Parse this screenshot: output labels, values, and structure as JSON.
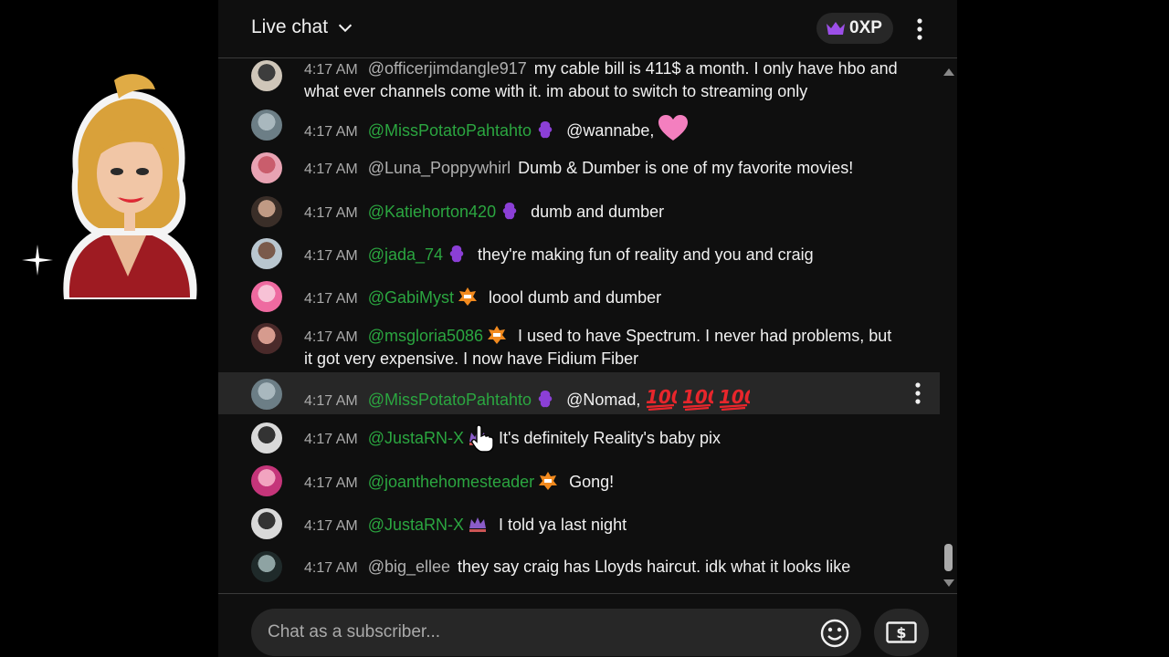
{
  "header": {
    "title": "Live chat",
    "xp_label": "0XP"
  },
  "messages": [
    {
      "time": "4:17 AM",
      "author": "@officerjimdangle917",
      "badge": null,
      "text": "my cable bill is 411$ a month. I only have hbo and what ever channels come with it. im about to switch to streaming only"
    },
    {
      "time": "4:17 AM",
      "author": "@MissPotatoPahtahto",
      "badge": "member-badge-purple",
      "text": "@wannabe,",
      "emoji": [
        "pink-heart"
      ]
    },
    {
      "time": "4:17 AM",
      "author": "@Luna_Poppywhirl",
      "badge": null,
      "text": "Dumb & Dumber is one of my favorite movies!"
    },
    {
      "time": "4:17 AM",
      "author": "@Katiehorton420",
      "badge": "member-badge-purple",
      "text": "dumb and dumber"
    },
    {
      "time": "4:17 AM",
      "author": "@jada_74",
      "badge": "member-badge-purple",
      "text": "they're making fun of reality and you and craig"
    },
    {
      "time": "4:17 AM",
      "author": "@GabiMyst",
      "badge": "member-badge-wtf",
      "text": "loool dumb and dumber"
    },
    {
      "time": "4:17 AM",
      "author": "@msgloria5086",
      "badge": "member-badge-wtf",
      "text": "I used to have Spectrum. I never had problems, but it got very expensive. I now have Fidium Fiber"
    },
    {
      "time": "4:17 AM",
      "author": "@MissPotatoPahtahto",
      "badge": "member-badge-purple",
      "text": "@Nomad,",
      "emoji": [
        "hundred",
        "hundred",
        "hundred"
      ],
      "highlighted": true
    },
    {
      "time": "4:17 AM",
      "author": "@JustaRN-X",
      "badge": "member-badge-crown",
      "text": "It's definitely Reality's baby pix"
    },
    {
      "time": "4:17 AM",
      "author": "@joanthehomesteader",
      "badge": "member-badge-wtf",
      "text": "Gong!"
    },
    {
      "time": "4:17 AM",
      "author": "@JustaRN-X",
      "badge": "member-badge-crown",
      "text": "I told ya last night"
    },
    {
      "time": "4:17 AM",
      "author": "@big_ellee",
      "badge": null,
      "text": "they say craig has Lloyds haircut. idk what it looks like"
    }
  ],
  "input": {
    "placeholder": "Chat as a subscriber..."
  },
  "colors": {
    "panel_bg": "#0f0f0f",
    "member_name": "#2ba640",
    "timestamp": "#aaaaaa",
    "highlight_row": "#272727",
    "purple_badge": "#8b3fd6"
  }
}
